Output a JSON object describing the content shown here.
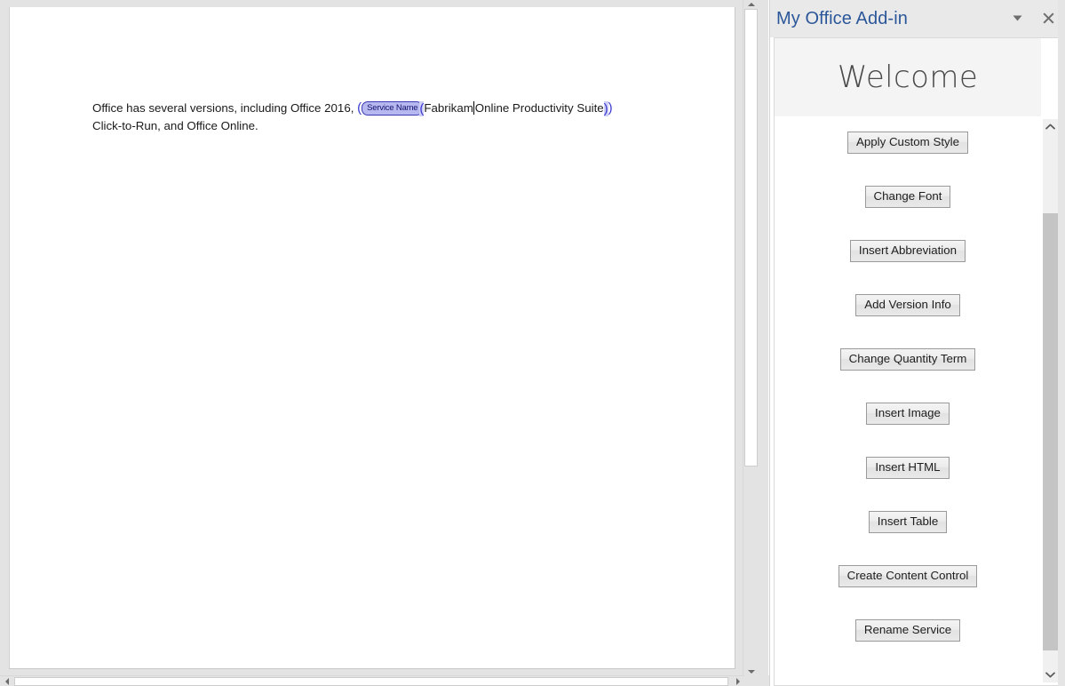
{
  "document": {
    "paragraph": {
      "lead_text": "Office has several versions, including Office 2016, ",
      "content_control": {
        "tag_label": "Service Name",
        "open_bracket": "(",
        "value_part1": "Fabrikam",
        "value_part2": "Online Productivity Suite",
        "close_bracket": ")",
        "outer_close": ")",
        "tag_bg_color": "#b8b8f0",
        "tag_text_color": "#11116e",
        "bracket_color": "#3a3ad0"
      },
      "line2_text": "Click-to-Run, and Office Online."
    },
    "scrollbars": {
      "vertical_up_icon": "triangle-up-icon",
      "vertical_down_icon": "triangle-down-icon",
      "horizontal_left_icon": "triangle-left-icon",
      "horizontal_right_icon": "triangle-right-icon"
    }
  },
  "taskpane": {
    "title": "My Office Add-in",
    "title_color": "#2b579a",
    "menu_icon": "chevron-down-icon",
    "close_icon": "close-icon",
    "welcome_heading": "Welcome",
    "buttons": [
      {
        "label": "Apply Custom Style"
      },
      {
        "label": "Change Font"
      },
      {
        "label": "Insert Abbreviation"
      },
      {
        "label": "Add Version Info"
      },
      {
        "label": "Change Quantity Term"
      },
      {
        "label": "Insert Image"
      },
      {
        "label": "Insert HTML"
      },
      {
        "label": "Insert Table"
      },
      {
        "label": "Create Content Control"
      },
      {
        "label": "Rename Service"
      }
    ],
    "scrollbar": {
      "up_icon": "chevron-up-icon",
      "down_icon": "chevron-down-icon"
    }
  }
}
